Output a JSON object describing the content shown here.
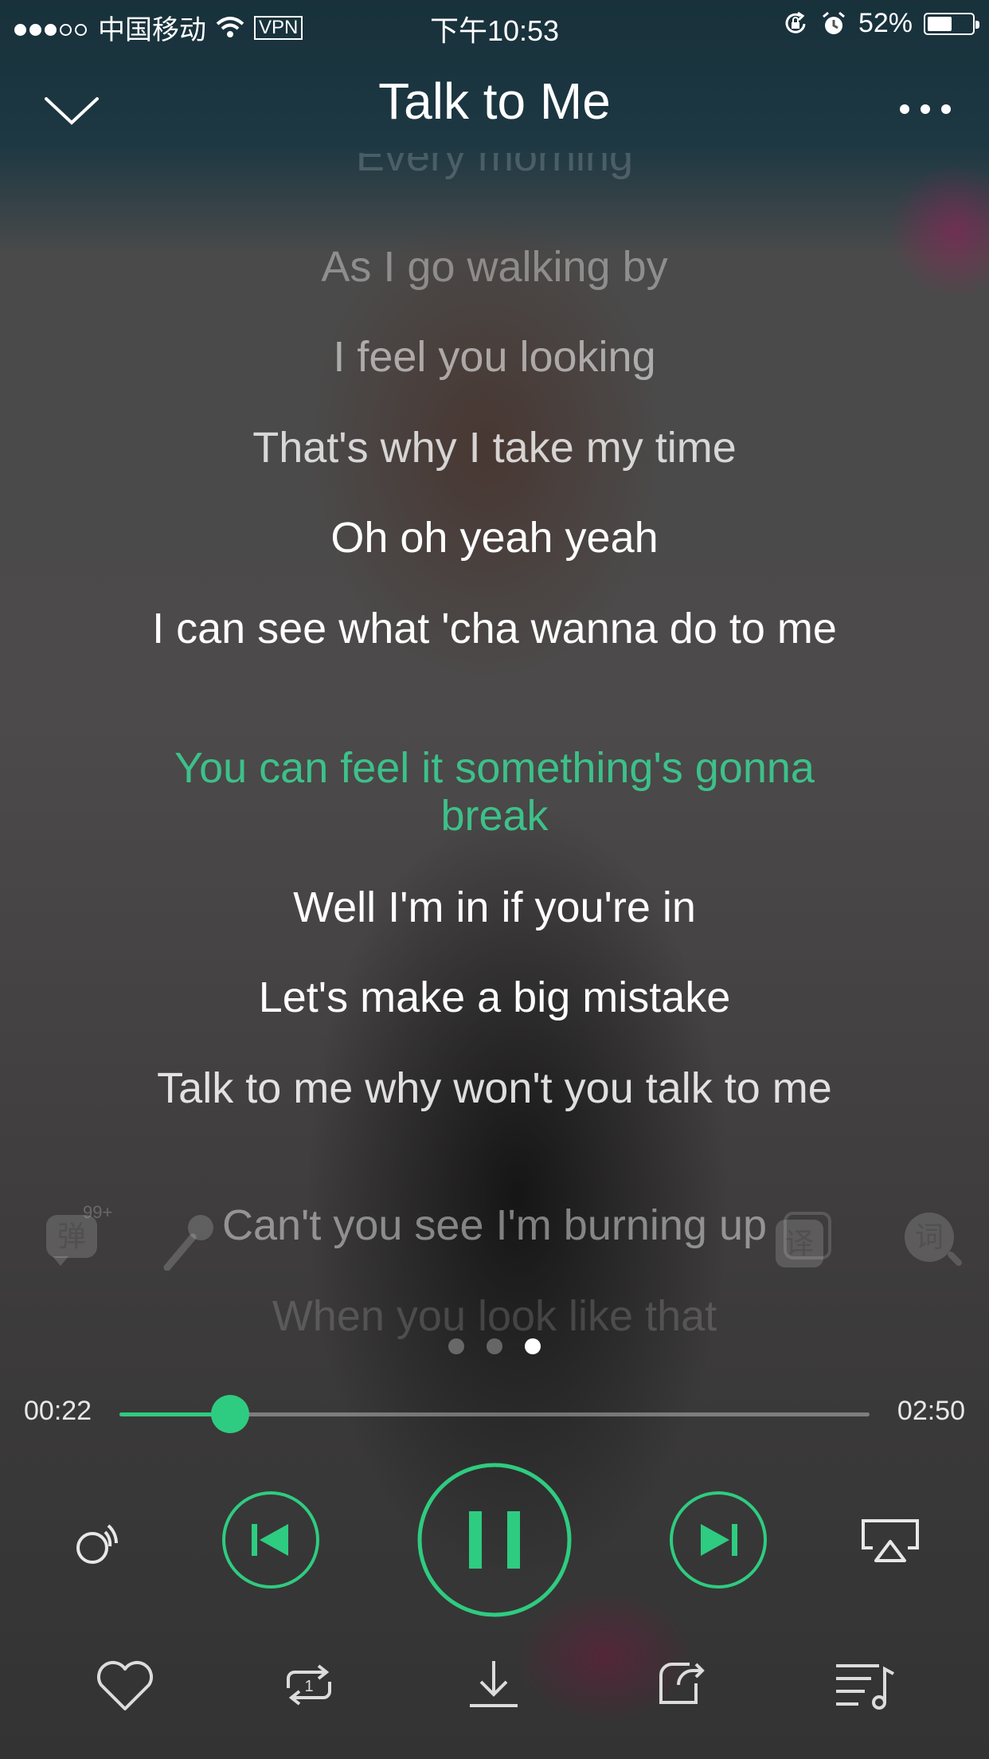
{
  "status_bar": {
    "carrier": "中国移动",
    "vpn": "VPN",
    "time": "下午10:53",
    "battery": "52%",
    "battery_level": 0.52
  },
  "player": {
    "title": "Talk to Me",
    "accent": "#2ecc80",
    "lyrics": [
      {
        "text": "Every morning",
        "state": "faded"
      },
      {
        "text": "As I go walking by",
        "state": "dim"
      },
      {
        "text": "I feel you looking",
        "state": "dim"
      },
      {
        "text": "That's why I take my time",
        "state": "normal"
      },
      {
        "text": "Oh oh yeah yeah",
        "state": "normal"
      },
      {
        "text": "I can see what 'cha wanna do to me",
        "state": "normal"
      },
      {
        "text": "You can feel it something's gonna break",
        "state": "current"
      },
      {
        "text": "Well I'm in if you're in",
        "state": "normal"
      },
      {
        "text": "Let's make a big mistake",
        "state": "normal"
      },
      {
        "text": "Talk to me  why won't you talk to me",
        "state": "normal"
      },
      {
        "text": "Can't you see I'm burning up",
        "state": "dim"
      },
      {
        "text": "When you look like that",
        "state": "faded"
      }
    ],
    "side_tools": {
      "danmaku_icon": "danmu-icon",
      "danmaku_glyph": "弹",
      "danmaku_badge": "99+",
      "mic_icon": "microphone-icon",
      "translate_glyph": "译",
      "lyrics_search_glyph": "词"
    },
    "pager": {
      "count": 3,
      "active": 2
    },
    "progress": {
      "elapsed": "00:22",
      "total": "02:50",
      "fraction": 0.148
    },
    "controls": [
      "sound-effect-icon",
      "previous-icon",
      "pause-icon",
      "next-icon",
      "airplay-icon"
    ],
    "bottom_actions": [
      "heart-icon",
      "repeat-one-icon",
      "download-icon",
      "share-icon",
      "playlist-icon"
    ]
  }
}
